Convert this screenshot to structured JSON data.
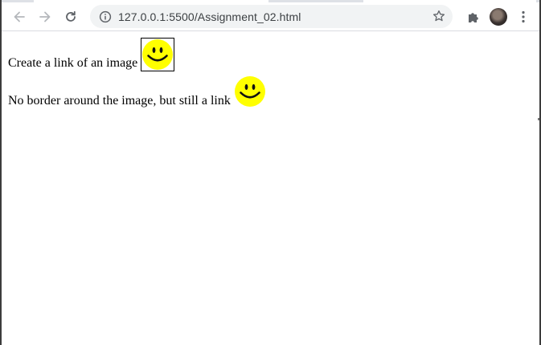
{
  "browser": {
    "url": "127.0.0.1:5500/Assignment_02.html",
    "icons": {
      "back": "back-arrow-icon",
      "forward": "forward-arrow-icon",
      "reload": "reload-icon",
      "info": "info-icon",
      "star": "bookmark-star-icon",
      "extensions": "puzzle-icon",
      "menu": "kebab-menu-icon"
    }
  },
  "page": {
    "line1_text": "Create a link of an image",
    "line2_text": "No border around the image, but still a link",
    "smiley_color": "#ffff00"
  }
}
